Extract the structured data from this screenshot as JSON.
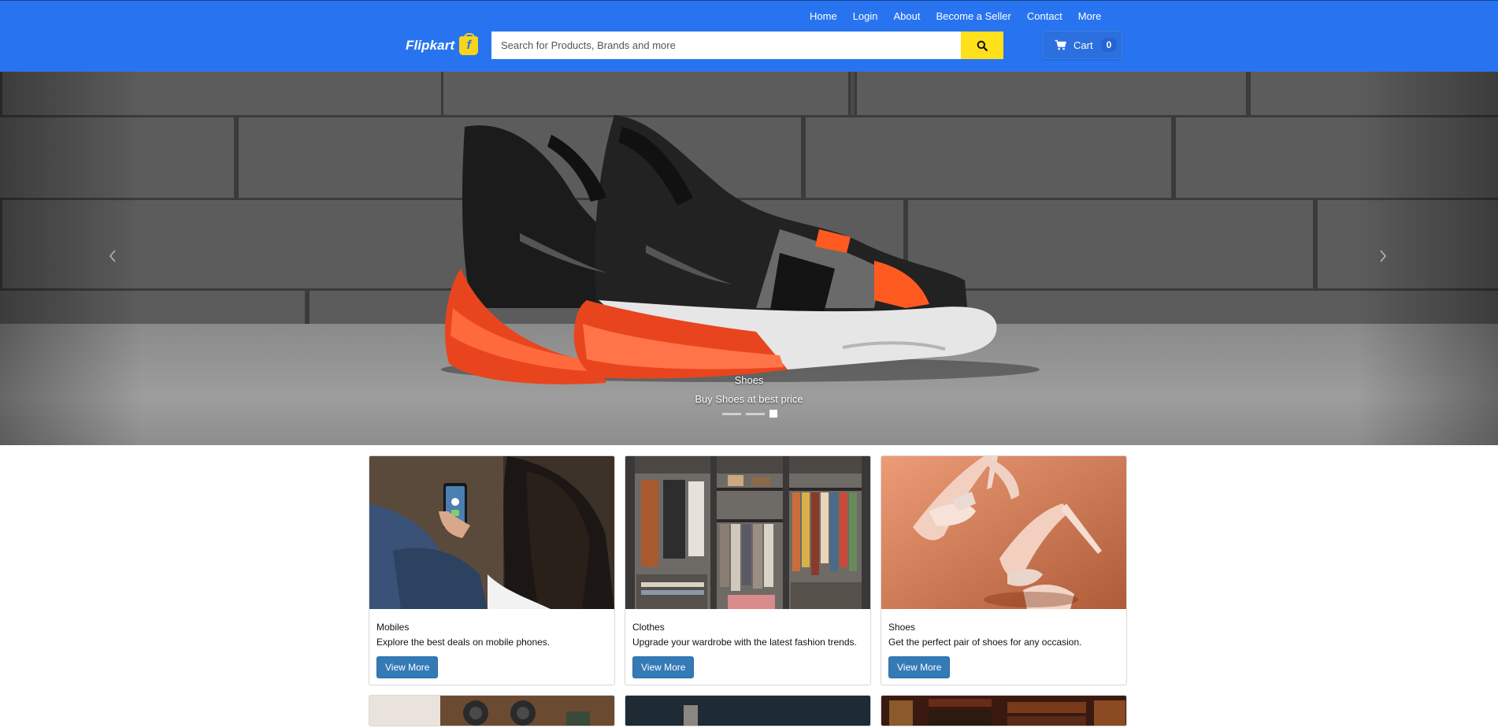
{
  "nav": {
    "links": [
      "Home",
      "Login",
      "About",
      "Become a Seller",
      "Contact",
      "More"
    ]
  },
  "brand": {
    "name": "Flipkart",
    "bag_letter": "f"
  },
  "search": {
    "placeholder": "Search for Products, Brands and more"
  },
  "cart": {
    "label": "Cart",
    "count": "0"
  },
  "carousel": {
    "title": "Shoes",
    "subtitle": "Buy Shoes at best price",
    "slides": 3,
    "active_index": 2
  },
  "cards": [
    {
      "title": "Mobiles",
      "description": "Explore the best deals on mobile phones.",
      "button": "View More"
    },
    {
      "title": "Clothes",
      "description": "Upgrade your wardrobe with the latest fashion trends.",
      "button": "View More"
    },
    {
      "title": "Shoes",
      "description": "Get the perfect pair of shoes for any occasion.",
      "button": "View More"
    }
  ],
  "icons": {
    "search": "search-icon",
    "cart": "cart-icon",
    "prev": "chevron-left-icon",
    "next": "chevron-right-icon"
  },
  "colors": {
    "header": "#2874f0",
    "search_button": "#ffe11b",
    "view_more_button": "#337ab7"
  }
}
